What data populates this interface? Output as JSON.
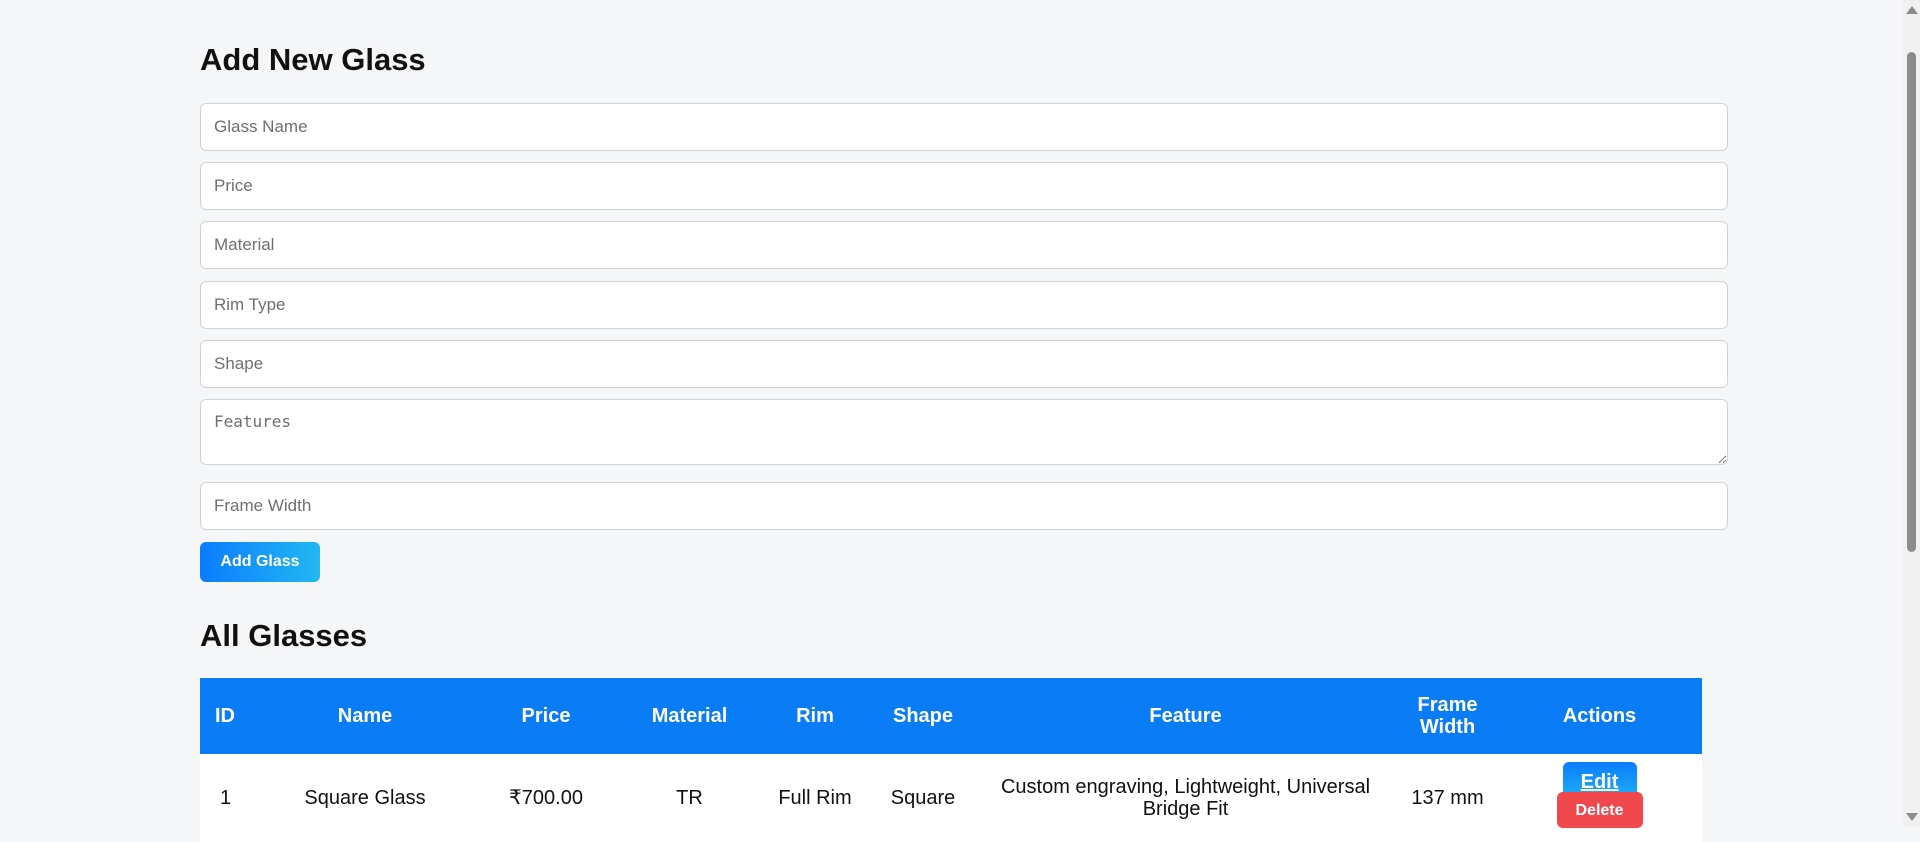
{
  "form": {
    "title": "Add New Glass",
    "name_placeholder": "Glass Name",
    "price_placeholder": "Price",
    "material_placeholder": "Material",
    "rim_placeholder": "Rim Type",
    "shape_placeholder": "Shape",
    "features_placeholder": "Features",
    "frame_width_placeholder": "Frame Width",
    "submit_label": "Add Glass"
  },
  "list": {
    "title": "All Glasses",
    "headers": {
      "id": "ID",
      "name": "Name",
      "price": "Price",
      "material": "Material",
      "rim": "Rim",
      "shape": "Shape",
      "feature": "Feature",
      "frame_width": "Frame Width",
      "actions": "Actions"
    },
    "rows": [
      {
        "id": "1",
        "name": "Square Glass",
        "price": "₹700.00",
        "material": "TR",
        "rim": "Full Rim",
        "shape": "Square",
        "feature": "Custom engraving, Lightweight, Universal Bridge Fit",
        "frame_width": "137 mm",
        "edit_label": "Edit",
        "delete_label": "Delete"
      }
    ]
  },
  "colors": {
    "accent": "#0a7cf5",
    "danger": "#f0484d",
    "background": "#f5f6f8"
  }
}
